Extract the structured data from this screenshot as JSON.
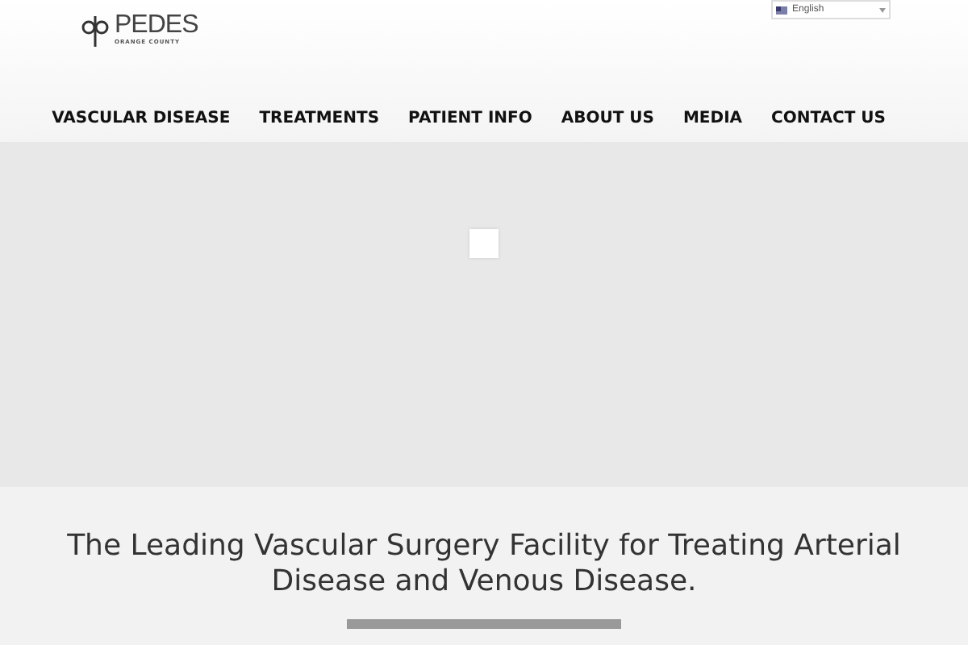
{
  "logo": {
    "name": "PEDES",
    "tagline": "ORANGE COUNTY"
  },
  "language": {
    "value": "English"
  },
  "nav": [
    {
      "label": "VASCULAR DISEASE"
    },
    {
      "label": "TREATMENTS"
    },
    {
      "label": "PATIENT INFO"
    },
    {
      "label": "ABOUT US"
    },
    {
      "label": "MEDIA"
    },
    {
      "label": "CONTACT US"
    }
  ],
  "hero": {
    "kind": "loading"
  },
  "headline": "The Leading Vascular Surgery Facility for Treating Arterial Disease and Venous Disease."
}
